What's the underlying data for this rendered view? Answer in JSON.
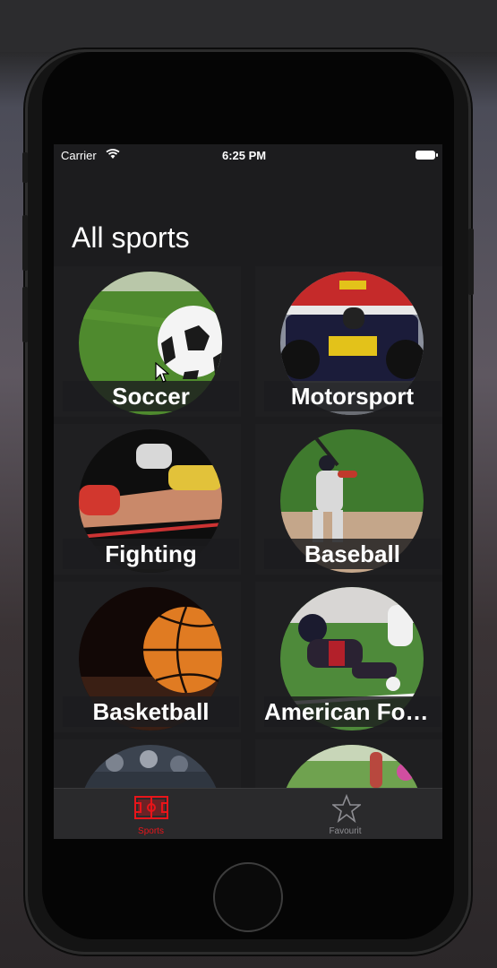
{
  "status_bar": {
    "carrier": "Carrier",
    "time": "6:25 PM"
  },
  "header": {
    "title": "All sports"
  },
  "sports": [
    {
      "label": "Soccer"
    },
    {
      "label": "Motorsport"
    },
    {
      "label": "Fighting"
    },
    {
      "label": "Baseball"
    },
    {
      "label": "Basketball"
    },
    {
      "label": "American Football"
    },
    {
      "label": ""
    },
    {
      "label": ""
    }
  ],
  "tabbar": {
    "tabs": [
      {
        "label": "Sports",
        "icon": "sports-icon",
        "active": true
      },
      {
        "label": "Favourit",
        "icon": "star-icon",
        "active": false
      }
    ]
  },
  "colors": {
    "accent": "#e8151a",
    "inactive": "#8e8e93",
    "background": "#1c1c1e"
  }
}
